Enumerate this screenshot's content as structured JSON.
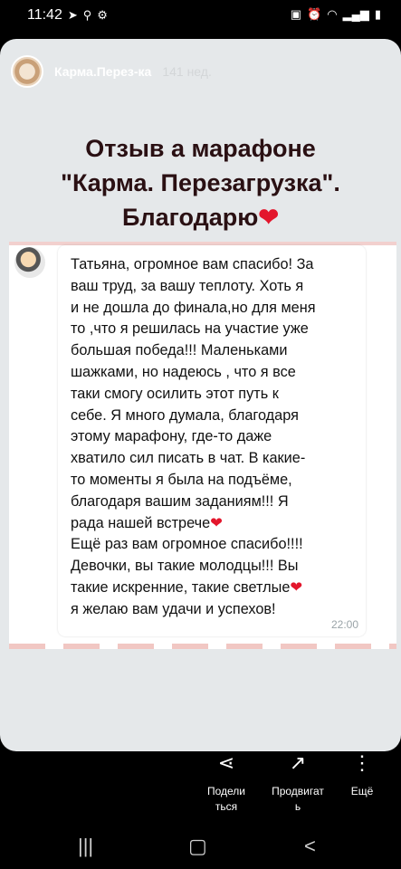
{
  "status_bar": {
    "time": "11:42"
  },
  "story": {
    "account_name": "Карма.Перез-ка",
    "post_age": "141 нед.",
    "headline_line1": "Отзыв а марафоне",
    "headline_line2": "\"Карма. Перезагрузка\".",
    "headline_line3": "Благодарю",
    "chat": {
      "message": "Татьяна, огромное вам спасибо! За\nваш труд, за вашу теплоту. Хоть я\nи не дошла до финала,но для меня\nто ,что я решилась на участие уже\nбольшая победа!!! Маленьками\nшажками, но надеюсь , что я все\nтаки смогу осилить этот путь к\nсебе. Я много думала, благодаря\nэтому марафону, где-то даже\nхватило сил писать в чат. В какие-\nто моменты я была на подъёме,\nблагодаря вашим заданиям!!! Я\nрада нашей встрече",
      "message_line2": "Ещё раз вам огромное спасибо!!!!\nДевочки, вы такие молодцы!!! Вы\nтакие искренние, такие светлые",
      "message_line3": "я желаю вам удачи и успехов!",
      "time": "22:00"
    }
  },
  "actions": {
    "share_label": "Подели\nться",
    "promote_label": "Продвигат\nь",
    "more_label": "Ещё"
  },
  "colors": {
    "headline": "#2a1013",
    "heart": "#e3162c",
    "story_bg": "#e5e8ea"
  }
}
